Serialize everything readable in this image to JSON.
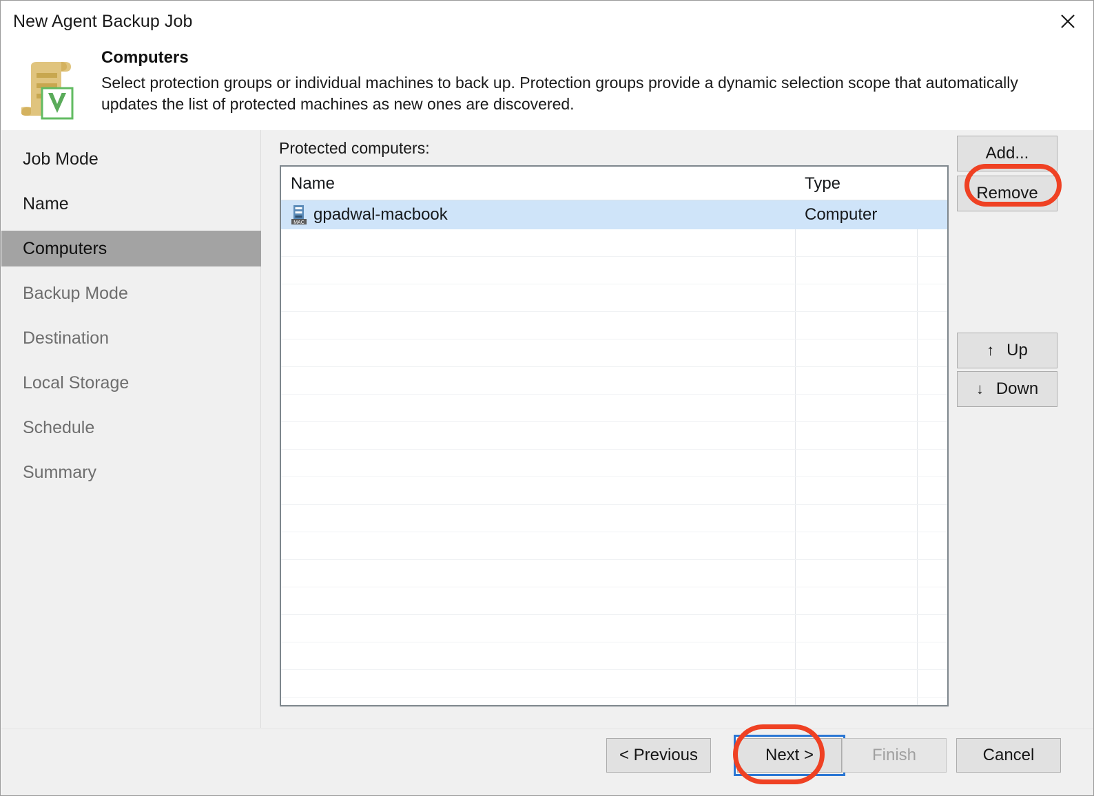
{
  "window": {
    "title": "New Agent Backup Job",
    "close_icon": "close-icon"
  },
  "header": {
    "icon": "veeam-job-scroll-icon",
    "title": "Computers",
    "description": "Select protection groups or individual machines to back up. Protection groups provide a dynamic selection scope that automatically updates the list of protected machines as new ones are discovered."
  },
  "sidebar": {
    "items": [
      {
        "label": "Job Mode",
        "state": "done"
      },
      {
        "label": "Name",
        "state": "done"
      },
      {
        "label": "Computers",
        "state": "active"
      },
      {
        "label": "Backup Mode",
        "state": "upcoming"
      },
      {
        "label": "Destination",
        "state": "upcoming"
      },
      {
        "label": "Local Storage",
        "state": "upcoming"
      },
      {
        "label": "Schedule",
        "state": "upcoming"
      },
      {
        "label": "Summary",
        "state": "upcoming"
      }
    ]
  },
  "main": {
    "list_label": "Protected computers:",
    "table": {
      "columns": [
        "Name",
        "Type"
      ],
      "rows": [
        {
          "name": "gpadwal-macbook",
          "type": "Computer",
          "icon": "mac-computer-icon",
          "selected": true
        }
      ],
      "empty_row_count": 17
    },
    "side_buttons": [
      {
        "id": "add",
        "label": "Add...",
        "annotated": true,
        "disabled": false
      },
      {
        "id": "remove",
        "label": "Remove",
        "annotated": false,
        "disabled": false
      },
      {
        "id": "up",
        "label": "Up",
        "arrow": "↑",
        "annotated": false,
        "disabled": false
      },
      {
        "id": "down",
        "label": "Down",
        "arrow": "↓",
        "annotated": false,
        "disabled": false
      }
    ]
  },
  "footer": {
    "buttons": [
      {
        "id": "previous",
        "label": "< Previous",
        "disabled": false,
        "focused": false,
        "annotated": false
      },
      {
        "id": "next",
        "label": "Next >",
        "disabled": false,
        "focused": true,
        "annotated": true
      },
      {
        "id": "finish",
        "label": "Finish",
        "disabled": true,
        "focused": false,
        "annotated": false
      },
      {
        "id": "cancel",
        "label": "Cancel",
        "disabled": false,
        "focused": false,
        "annotated": false
      }
    ]
  },
  "colors": {
    "annotation": "#ef4123",
    "focus_border": "#2b77d4",
    "selection": "#cfe4f9",
    "sidebar_active": "#a3a3a3",
    "body_background": "#f0f0f0",
    "icon_gold": "#dcbf70",
    "icon_green": "#5cb85c"
  }
}
